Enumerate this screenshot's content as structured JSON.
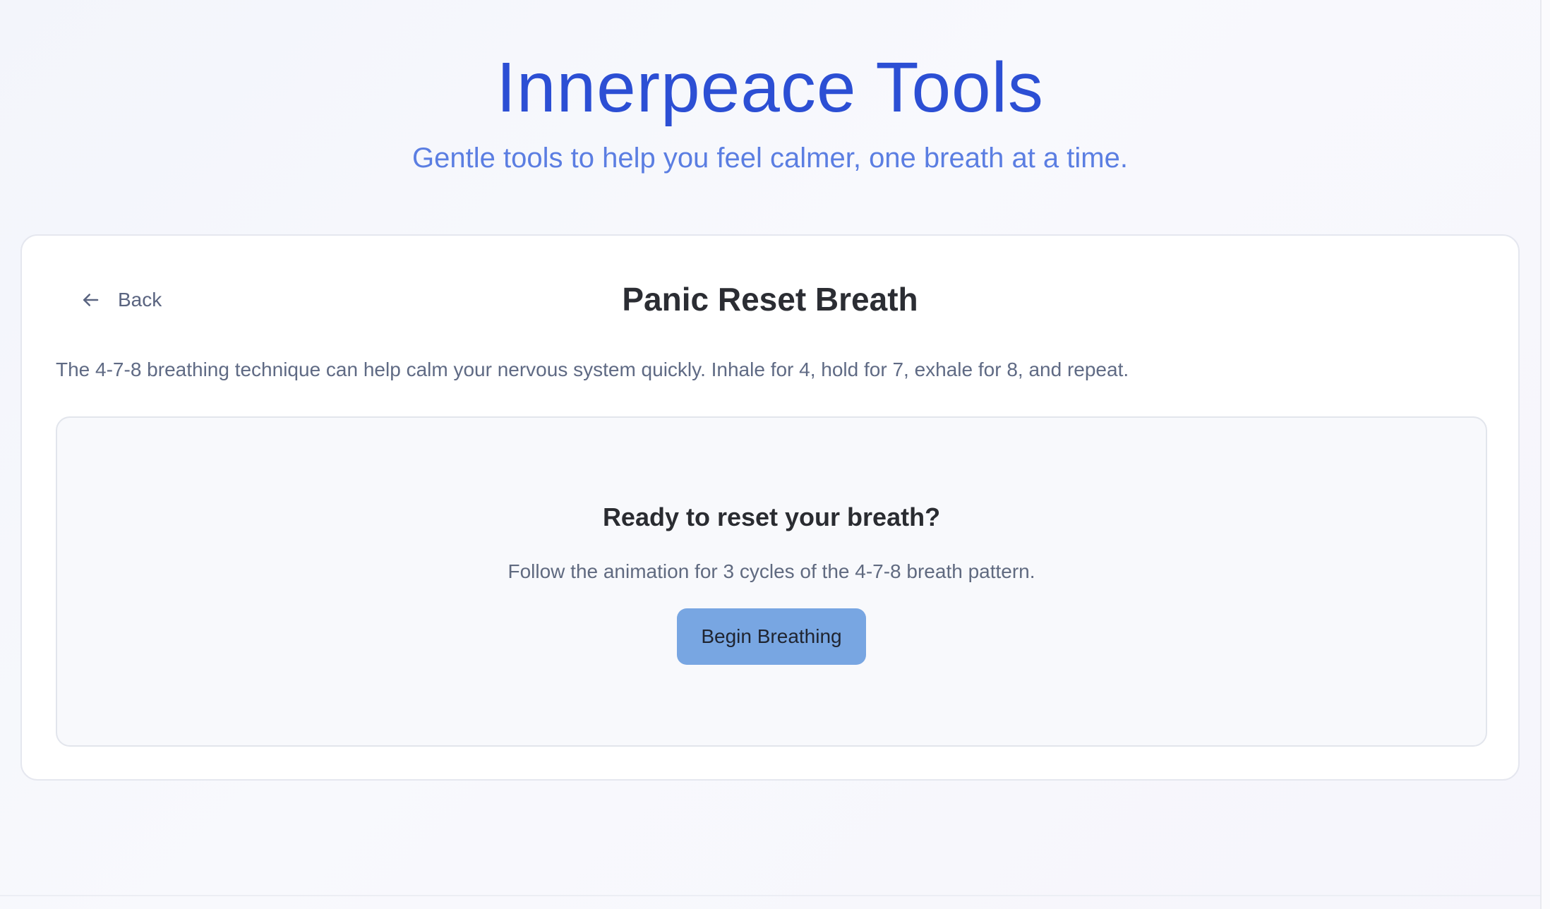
{
  "header": {
    "title": "Innerpeace Tools",
    "subtitle": "Gentle tools to help you feel calmer, one breath at a time."
  },
  "tool": {
    "back_label": "Back",
    "back_icon": "arrow-left-icon",
    "title": "Panic Reset Breath",
    "description": "The 4-7-8 breathing technique can help calm your nervous system quickly. Inhale for 4, hold for 7, exhale for 8, and repeat."
  },
  "exercise": {
    "heading": "Ready to reset your breath?",
    "text": "Follow the animation for 3 cycles of the 4-7-8 breath pattern.",
    "button_label": "Begin Breathing"
  },
  "colors": {
    "brand": "#2c4fd4",
    "subtitle": "#5b7ee2",
    "button": "#78a6e2"
  }
}
